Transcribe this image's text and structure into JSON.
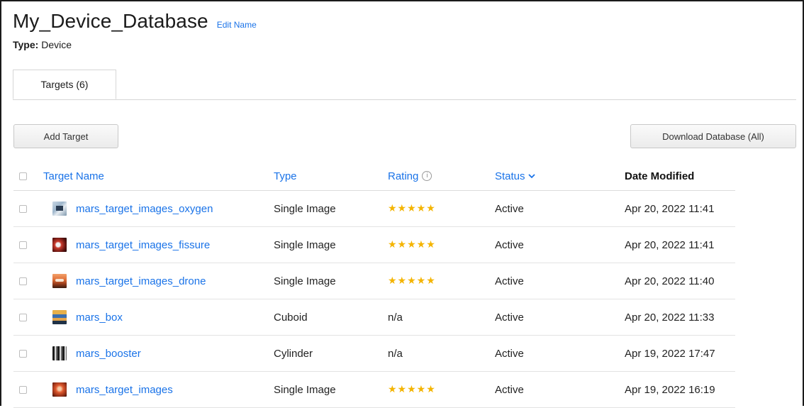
{
  "database": {
    "title": "My_Device_Database",
    "edit_label": "Edit Name",
    "type_key": "Type:",
    "type_value": "Device"
  },
  "tabs": [
    {
      "label": "Targets (6)"
    }
  ],
  "toolbar": {
    "add_label": "Add Target",
    "download_label": "Download Database (All)"
  },
  "table": {
    "headers": {
      "name": "Target Name",
      "type": "Type",
      "rating": "Rating",
      "rating_info_icon": "info-icon",
      "status": "Status",
      "status_sort_icon": "chevron-down-icon",
      "date": "Date Modified"
    },
    "rows": [
      {
        "name": "mars_target_images_oxygen",
        "type": "Single Image",
        "rating": "★★★★★",
        "rating_stars": 5,
        "status": "Active",
        "date": "Apr 20, 2022 11:41"
      },
      {
        "name": "mars_target_images_fissure",
        "type": "Single Image",
        "rating": "★★★★★",
        "rating_stars": 5,
        "status": "Active",
        "date": "Apr 20, 2022 11:41"
      },
      {
        "name": "mars_target_images_drone",
        "type": "Single Image",
        "rating": "★★★★★",
        "rating_stars": 5,
        "status": "Active",
        "date": "Apr 20, 2022 11:40"
      },
      {
        "name": "mars_box",
        "type": "Cuboid",
        "rating": "n/a",
        "status": "Active",
        "date": "Apr 20, 2022 11:33"
      },
      {
        "name": "mars_booster",
        "type": "Cylinder",
        "rating": "n/a",
        "status": "Active",
        "date": "Apr 19, 2022 17:47"
      },
      {
        "name": "mars_target_images",
        "type": "Single Image",
        "rating": "★★★★★",
        "rating_stars": 5,
        "status": "Active",
        "date": "Apr 19, 2022 16:19"
      }
    ]
  },
  "colors": {
    "link": "#1a73e8",
    "star": "#f4b400",
    "border": "#1a1a1a"
  }
}
